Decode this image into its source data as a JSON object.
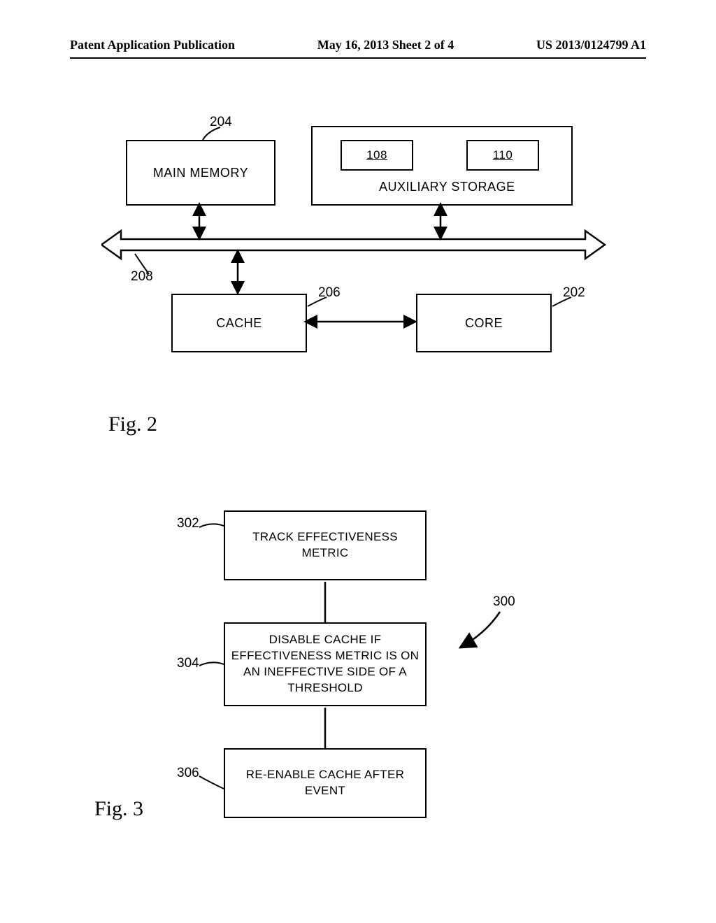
{
  "header": {
    "left": "Patent Application Publication",
    "center": "May 16, 2013  Sheet 2 of 4",
    "right": "US 2013/0124799 A1"
  },
  "fig2": {
    "main_memory": "MAIN MEMORY",
    "aux_storage_label": "AUXILIARY STORAGE",
    "aux_inner_a": "108",
    "aux_inner_b": "110",
    "cache": "CACHE",
    "core": "CORE",
    "ref_204": "204",
    "ref_208": "208",
    "ref_206": "206",
    "ref_202": "202",
    "caption": "Fig. 2"
  },
  "fig3": {
    "step_302": "TRACK EFFECTIVENESS METRIC",
    "step_304": "DISABLE CACHE IF EFFECTIVENESS METRIC IS ON AN INEFFECTIVE SIDE OF A THRESHOLD",
    "step_306": "RE-ENABLE CACHE AFTER EVENT",
    "ref_302": "302",
    "ref_304": "304",
    "ref_306": "306",
    "ref_300": "300",
    "caption": "Fig. 3"
  }
}
